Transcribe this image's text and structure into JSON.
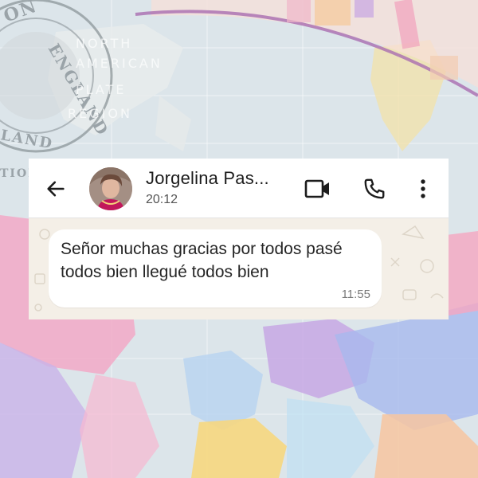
{
  "background": {
    "stamp_top_text": "ON",
    "stamp_side_text": "ENGLAND",
    "stamp_bottom_text": "LAND",
    "stamp_left_text": "TION",
    "map_labels": [
      "NORTH",
      "AMERICAN",
      "PLATE",
      "REGION"
    ],
    "colors": {
      "sky": "#dfe6ea",
      "pink": "#f0a9c6",
      "lavender": "#c7a6e3",
      "blue": "#8fb8e6",
      "yellow": "#f3d27a",
      "orange": "#f2b27d"
    }
  },
  "header": {
    "back_icon": "arrow-left-icon",
    "contact_name": "Jorgelina Pas...",
    "last_seen": "20:12",
    "video_icon": "video-camera-icon",
    "call_icon": "phone-icon",
    "menu_icon": "more-vertical-icon"
  },
  "message": {
    "text": "Señor muchas gracias por todos pasé todos bien llegué todos bien",
    "time": "11:55",
    "direction": "incoming"
  },
  "colors": {
    "header_bg": "#ffffff",
    "chat_bg": "#f4efe7",
    "bubble_bg": "#ffffff",
    "text": "#262626",
    "icon": "#1c1c1c"
  }
}
